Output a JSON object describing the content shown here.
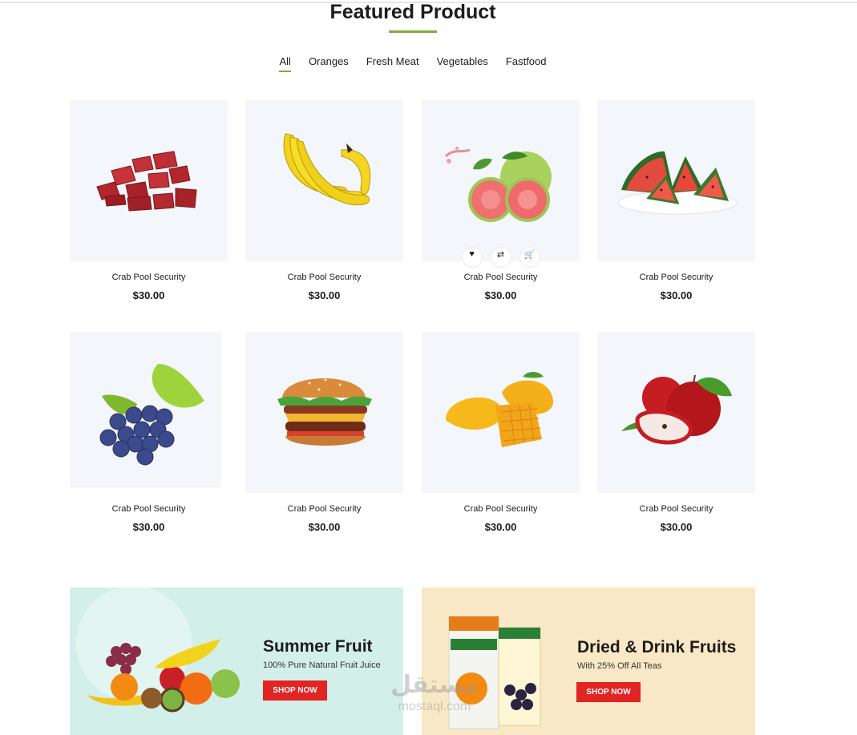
{
  "section": {
    "title": "Featured Product"
  },
  "filters": [
    {
      "label": "All",
      "active": true
    },
    {
      "label": "Oranges",
      "active": false
    },
    {
      "label": "Fresh Meat",
      "active": false
    },
    {
      "label": "Vegetables",
      "active": false
    },
    {
      "label": "Fastfood",
      "active": false
    }
  ],
  "products": [
    {
      "name": "Crab Pool Security",
      "price": "$30.00",
      "image": "raw-meat-cubes"
    },
    {
      "name": "Crab Pool Security",
      "price": "$30.00",
      "image": "bananas"
    },
    {
      "name": "Crab Pool Security",
      "price": "$30.00",
      "image": "guava"
    },
    {
      "name": "Crab Pool Security",
      "price": "$30.00",
      "image": "watermelon-slices"
    },
    {
      "name": "Crab Pool Security",
      "price": "$30.00",
      "image": "grapes"
    },
    {
      "name": "Crab Pool Security",
      "price": "$30.00",
      "image": "burger"
    },
    {
      "name": "Crab Pool Security",
      "price": "$30.00",
      "image": "mango"
    },
    {
      "name": "Crab Pool Security",
      "price": "$30.00",
      "image": "red-apples"
    }
  ],
  "hover_actions": {
    "icons": [
      "heart-icon",
      "retweet-icon",
      "cart-icon"
    ]
  },
  "banners": [
    {
      "title": "Summer Fruit",
      "subtitle": "100% Pure Natural Fruit Juice",
      "button": "SHOP NOW",
      "background": "#d3efea"
    },
    {
      "title": "Dried & Drink Fruits",
      "subtitle": "With 25% Off All Teas",
      "button": "SHOP NOW",
      "background": "#f8e8c5"
    }
  ],
  "watermark": {
    "arabic": "مستقل",
    "latin": "mostaql.com"
  },
  "colors": {
    "accent": "#7fad39",
    "button": "#e12424",
    "card_bg": "#f3f6fa"
  }
}
